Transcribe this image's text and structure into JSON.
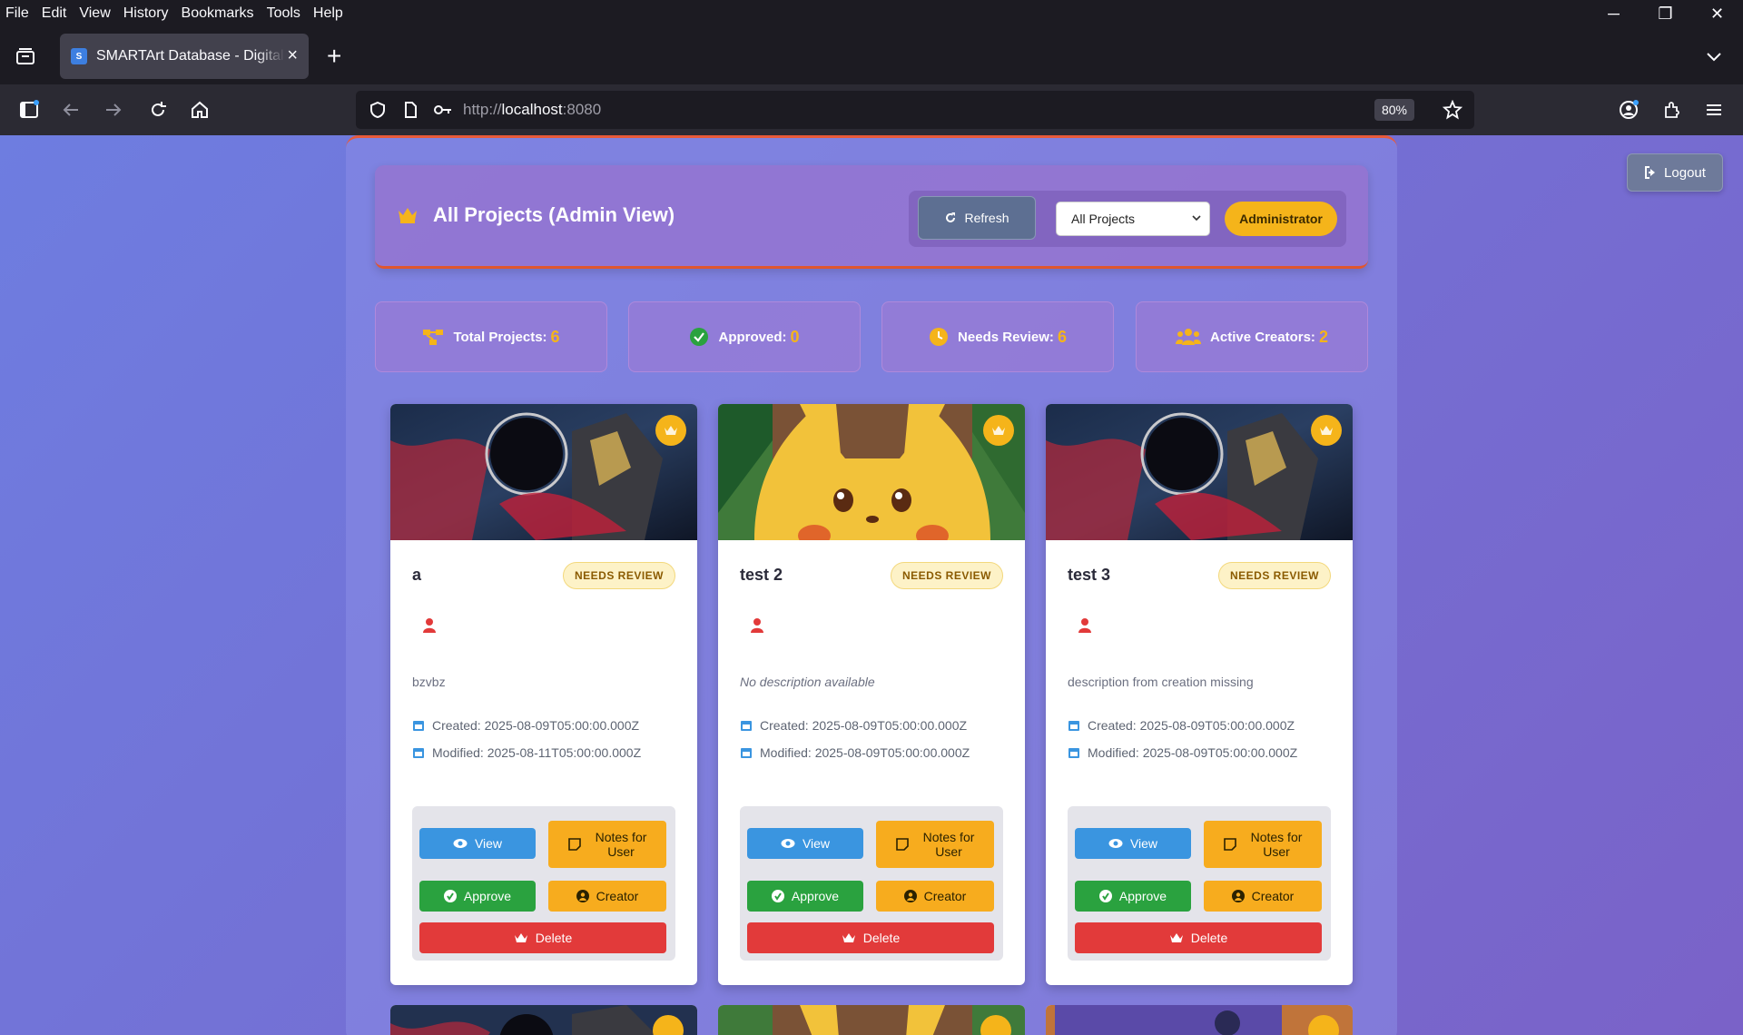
{
  "menubar": {
    "items": [
      "File",
      "Edit",
      "View",
      "History",
      "Bookmarks",
      "Tools",
      "Help"
    ]
  },
  "window_controls": {
    "minimize": "─",
    "restore": "❐",
    "close": "✕"
  },
  "tab": {
    "title": "SMARTArt Database - Digital A",
    "favicon_letter": "S"
  },
  "navbar": {
    "url_prefix": "http://",
    "url_host": "localhost",
    "url_port": ":8080",
    "zoom": "80%"
  },
  "page": {
    "logout_label": "Logout",
    "header_title": "All Projects (Admin View)",
    "refresh_label": "Refresh",
    "filter_selected": "All Projects",
    "role_badge": "Administrator",
    "stats": [
      {
        "label": "Total Projects:",
        "value": "6",
        "icon": "project-diagram-icon"
      },
      {
        "label": "Approved:",
        "value": "0",
        "icon": "check-circle-icon"
      },
      {
        "label": "Needs Review:",
        "value": "6",
        "icon": "clock-icon"
      },
      {
        "label": "Active Creators:",
        "value": "2",
        "icon": "users-icon"
      }
    ],
    "cards": [
      {
        "title": "a",
        "status": "NEEDS REVIEW",
        "description": "bzvbz",
        "created": "Created: 2025-08-09T05:00:00.000Z",
        "modified": "Modified: 2025-08-11T05:00:00.000Z",
        "thumb": "dark-armor-art"
      },
      {
        "title": "test 2",
        "status": "NEEDS REVIEW",
        "description": "No description available",
        "created": "Created: 2025-08-09T05:00:00.000Z",
        "modified": "Modified: 2025-08-09T05:00:00.000Z",
        "thumb": "pikachu-art"
      },
      {
        "title": "test 3",
        "status": "NEEDS REVIEW",
        "description": "description from creation missing",
        "created": "Created: 2025-08-09T05:00:00.000Z",
        "modified": "Modified: 2025-08-09T05:00:00.000Z",
        "thumb": "dark-armor-art"
      }
    ],
    "buttons": {
      "view": "View",
      "notes_line1": "Notes for",
      "notes_line2": "User",
      "approve": "Approve",
      "creator": "Creator",
      "delete": "Delete"
    }
  },
  "colors": {
    "accent_gold": "#f5b41a",
    "view_blue": "#3a95e0",
    "approve_green": "#2aa23f",
    "delete_red": "#e23a3a"
  }
}
